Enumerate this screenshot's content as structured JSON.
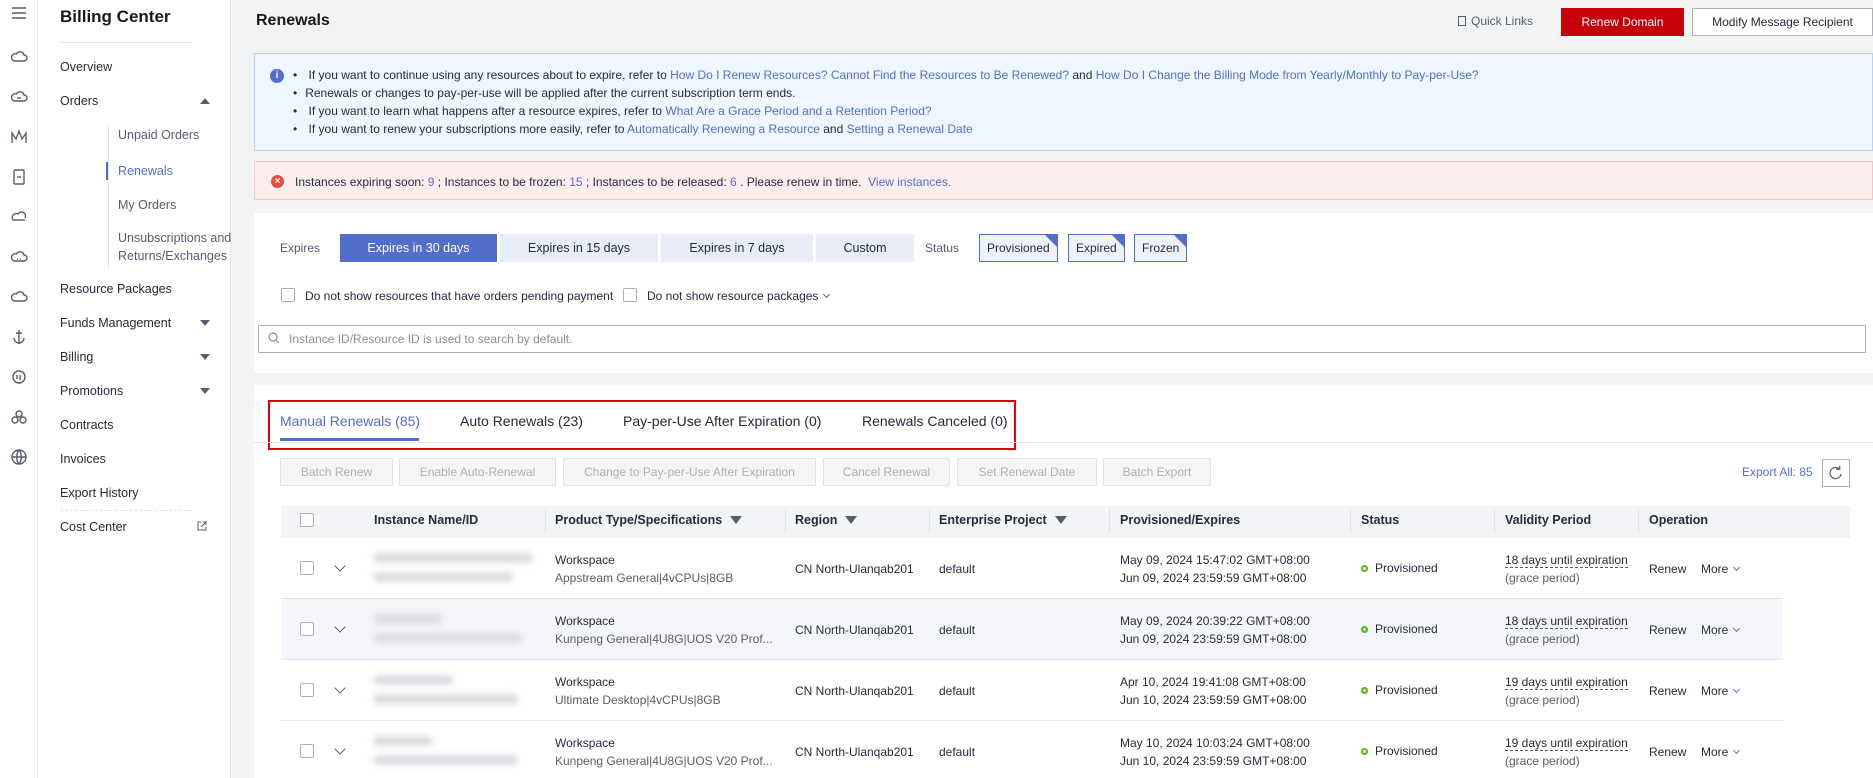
{
  "nav": {
    "title": "Billing Center",
    "overview": "Overview",
    "orders": "Orders",
    "unpaid_orders": "Unpaid Orders",
    "renewals": "Renewals",
    "my_orders": "My Orders",
    "unsubscriptions_1": "Unsubscriptions and",
    "unsubscriptions_2": "Returns/Exchanges",
    "resource_packages": "Resource Packages",
    "funds_management": "Funds Management",
    "billing": "Billing",
    "promotions": "Promotions",
    "contracts": "Contracts",
    "invoices": "Invoices",
    "export_history": "Export History",
    "cost_center": "Cost Center"
  },
  "header": {
    "title": "Renewals",
    "quick_links": "Quick Links",
    "renew_domain": "Renew Domain",
    "modify_recipient": "Modify Message Recipient"
  },
  "info": {
    "line1_text": "If you want to continue using any resources about to expire, refer to",
    "line1_link1": "How Do I Renew Resources? Cannot Find the Resources to Be Renewed?",
    "line1_and": "and",
    "line1_link2": "How Do I Change the Billing Mode from Yearly/Monthly to Pay-per-Use?",
    "line2_text": "Renewals or changes to pay-per-use will be applied after the current subscription term ends.",
    "line3_text": "If you want to learn what happens after a resource expires, refer to",
    "line3_link": "What Are a Grace Period and a Retention Period?",
    "line4_text": "If you want to renew your subscriptions more easily, refer to",
    "line4_link1": "Automatically Renewing a Resource",
    "line4_and": "and",
    "line4_link2": "Setting a Renewal Date"
  },
  "alert": {
    "expiring_label": "Instances expiring soon:",
    "expiring_count": "9",
    "frozen_label": "; Instances to be frozen:",
    "frozen_count": "15",
    "released_label": "; Instances to be released:",
    "released_count": "6",
    "tail": ". Please renew in time.",
    "view_link": "View instances."
  },
  "filters": {
    "expires_label": "Expires",
    "expires_options": [
      "Expires in 30 days",
      "Expires in 15 days",
      "Expires in 7 days",
      "Custom"
    ],
    "status_label": "Status",
    "status_tags": [
      "Provisioned",
      "Expired",
      "Frozen"
    ],
    "hide_pending": "Do not show resources that have orders pending payment",
    "hide_packages": "Do not show resource packages",
    "search_placeholder": "Instance ID/Resource ID is used to search by default."
  },
  "tabs": [
    "Manual Renewals (85)",
    "Auto Renewals (23)",
    "Pay-per-Use After Expiration (0)",
    "Renewals Canceled (0)"
  ],
  "actions": [
    "Batch Renew",
    "Enable Auto-Renewal",
    "Change to Pay-per-Use After Expiration",
    "Cancel Renewal",
    "Set Renewal Date",
    "Batch Export"
  ],
  "export_all": "Export All: 85",
  "columns": [
    "Instance Name/ID",
    "Product Type/Specifications",
    "Region",
    "Enterprise Project",
    "Provisioned/Expires",
    "Status",
    "Validity Period",
    "Operation"
  ],
  "rows": [
    {
      "product": "Workspace",
      "spec": "Appstream General|4vCPUs|8GB",
      "region": "CN North-Ulanqab201",
      "project": "default",
      "provisioned": "May 09, 2024 15:47:02 GMT+08:00",
      "expires": "Jun 09, 2024 23:59:59 GMT+08:00",
      "status": "Provisioned",
      "validity": "18 days until expiration",
      "validity_note": "(grace period)",
      "renew": "Renew",
      "more": "More"
    },
    {
      "product": "Workspace",
      "spec": "Kunpeng General|4U8G|UOS V20 Prof...",
      "region": "CN North-Ulanqab201",
      "project": "default",
      "provisioned": "May 09, 2024 20:39:22 GMT+08:00",
      "expires": "Jun 09, 2024 23:59:59 GMT+08:00",
      "status": "Provisioned",
      "validity": "18 days until expiration",
      "validity_note": "(grace period)",
      "renew": "Renew",
      "more": "More"
    },
    {
      "product": "Workspace",
      "spec": "Ultimate Desktop|4vCPUs|8GB",
      "region": "CN North-Ulanqab201",
      "project": "default",
      "provisioned": "Apr 10, 2024 19:41:08 GMT+08:00",
      "expires": "Jun 10, 2024 23:59:59 GMT+08:00",
      "status": "Provisioned",
      "validity": "19 days until expiration",
      "validity_note": "(grace period)",
      "renew": "Renew",
      "more": "More"
    },
    {
      "product": "Workspace",
      "spec": "Kunpeng General|4U8G|UOS V20 Prof...",
      "region": "CN North-Ulanqab201",
      "project": "default",
      "provisioned": "May 10, 2024 10:03:24 GMT+08:00",
      "expires": "Jun 10, 2024 23:59:59 GMT+08:00",
      "status": "Provisioned",
      "validity": "19 days until expiration",
      "validity_note": "(grace period)",
      "renew": "Renew",
      "more": "More"
    }
  ],
  "colors": {
    "accent": "#526ecc",
    "brand_red": "#c7000b",
    "success": "#50b80f",
    "alert_bg": "#fdeeee",
    "info_bg": "#eef6ff"
  }
}
